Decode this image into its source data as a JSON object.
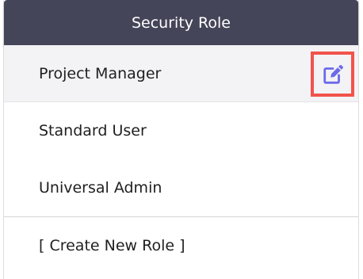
{
  "header": {
    "title": "Security Role"
  },
  "roles": [
    {
      "label": "Project Manager",
      "selected": true
    },
    {
      "label": "Standard User",
      "selected": false
    },
    {
      "label": "Universal Admin",
      "selected": false
    }
  ],
  "actions": {
    "create_new_role": "[ Create New Role ]"
  },
  "icons": {
    "edit": "edit-icon"
  },
  "colors": {
    "header_bg": "#454559",
    "edit_icon": "#6b6bea",
    "highlight_border": "#f2534c",
    "selected_row_bg": "#f3f3f5"
  }
}
